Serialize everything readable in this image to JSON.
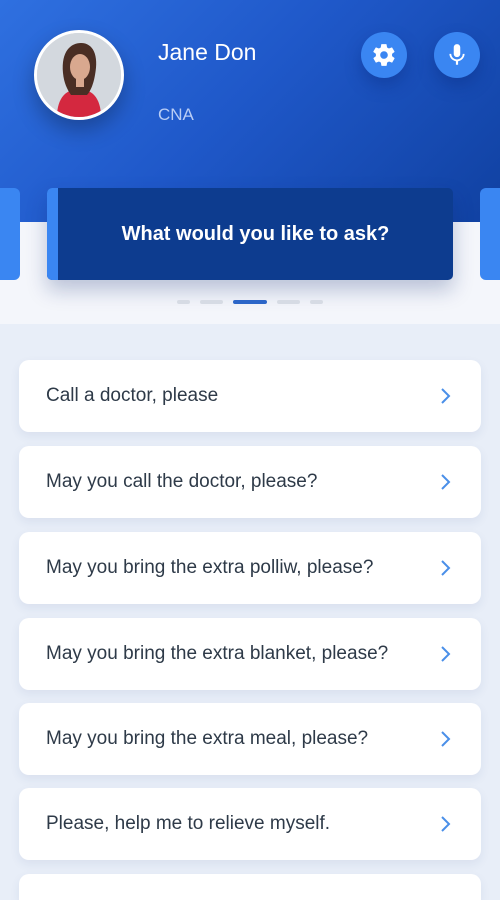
{
  "profile": {
    "name": "Jane Don",
    "role": "CNA"
  },
  "toolbar": {
    "settings_icon": "gear-icon",
    "mic_icon": "microphone-icon"
  },
  "carousel": {
    "prompt": "What would you like to ask?",
    "active_index": 2,
    "page_count": 5
  },
  "requests": [
    {
      "label": "Call a doctor, please"
    },
    {
      "label": "May you call the doctor, please?"
    },
    {
      "label": "May you bring the extra polliw, please?"
    },
    {
      "label": "May you bring the extra blanket, please?"
    },
    {
      "label": "May you bring the extra meal, please?"
    },
    {
      "label": "Please, help me to relieve myself."
    },
    {
      "label": ""
    }
  ],
  "colors": {
    "header_blue": "#1f58c9",
    "accent_blue": "#3a86f2",
    "prompt_navy": "#0d3c8f"
  }
}
